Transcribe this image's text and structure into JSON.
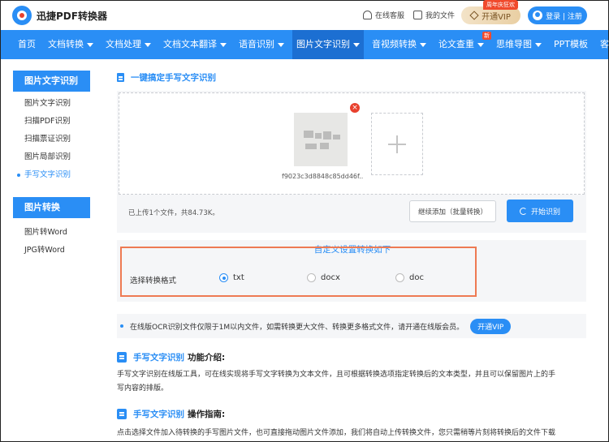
{
  "header": {
    "logo_text": "迅捷PDF转换器",
    "service_label": "在线客服",
    "files_label": "我的文件",
    "vip_label": "开通VIP",
    "vip_tag": "周年庆狂欢",
    "login_label": "登录 | 注册"
  },
  "nav": {
    "items": [
      {
        "label": "首页",
        "caret": false
      },
      {
        "label": "文档转换",
        "caret": true
      },
      {
        "label": "文档处理",
        "caret": true
      },
      {
        "label": "文档文本翻译",
        "caret": true
      },
      {
        "label": "语音识别",
        "caret": true
      },
      {
        "label": "图片文字识别",
        "caret": true,
        "active": true
      },
      {
        "label": "音视频转换",
        "caret": true
      },
      {
        "label": "论文查重",
        "caret": true,
        "badge": "新"
      },
      {
        "label": "思维导图",
        "caret": true
      },
      {
        "label": "PPT模板",
        "caret": false
      },
      {
        "label": "客户端",
        "caret": true
      }
    ]
  },
  "sidebar": {
    "group1_title": "图片文字识别",
    "group1_items": [
      "图片文字识别",
      "扫描PDF识别",
      "扫描票证识别",
      "图片局部识别",
      "手写文字识别"
    ],
    "group1_active": 4,
    "group2_title": "图片转换",
    "group2_items": [
      "图片转Word",
      "JPG转Word"
    ]
  },
  "main": {
    "section_title": "一键搞定手写文字识别",
    "file_name": "f9023c3d8848c85dd46f...",
    "upload_status": "已上传1个文件，共84.73K。",
    "continue_label": "继续添加（批量转换）",
    "start_label": "开始识别",
    "settings_title": "自定义设置转换如下",
    "format_label": "选择转换格式",
    "formats": [
      "txt",
      "docx",
      "doc"
    ],
    "selected_format": "txt",
    "notice_text": "在线版OCR识别文件仅限于1M以内文件，如需转换更大文件、转换更多格式文件，请开通在线版会员。",
    "notice_vip": "开通VIP",
    "intro_title_blue": "手写文字识别",
    "intro_title_dark": "功能介绍:",
    "intro_text_1": "手写文字识别在线版工具，可在线实现将手写文字转换为文本文件，且可根据转换选项指定转换后的文本类型，并且可以保留图片上的手",
    "intro_text_2": "写内容的排版。",
    "guide_title_blue": "手写文字识别",
    "guide_title_dark": "操作指南:",
    "guide_text": "点击选择文件加入待转换的手写图片文件，也可直接拖动图片文件添加，我们将自动上传转换文件，您只需稍等片刻将转换后的文件下载"
  }
}
